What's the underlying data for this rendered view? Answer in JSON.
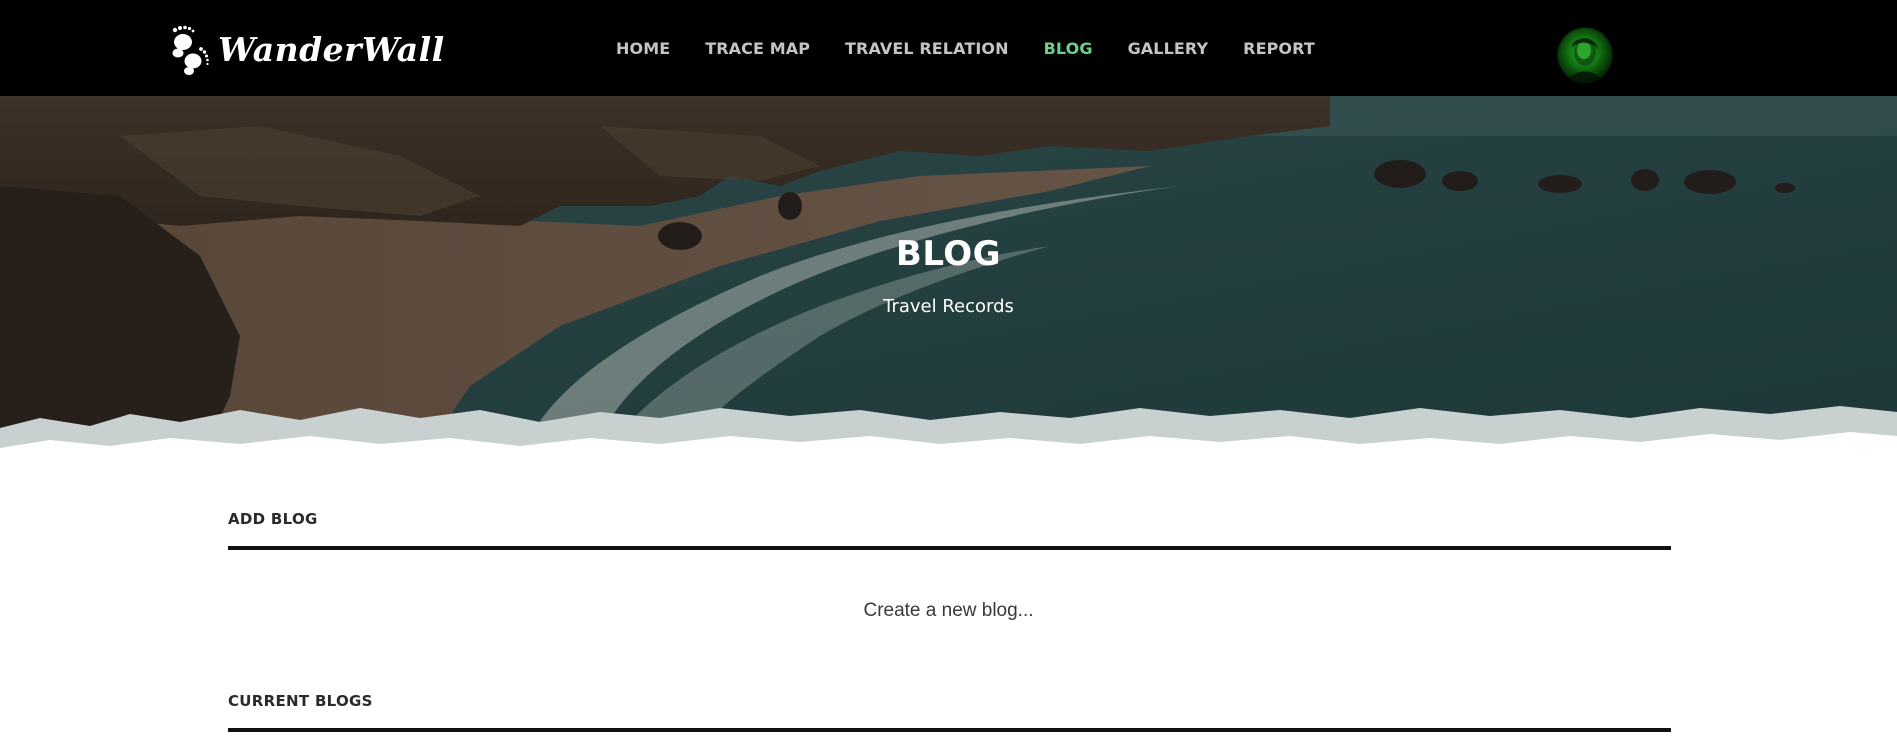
{
  "brand": {
    "name": "WanderWall",
    "logo_icon": "footprints-icon"
  },
  "nav": {
    "items": [
      {
        "label": "HOME",
        "active": false
      },
      {
        "label": "TRACE MAP",
        "active": false
      },
      {
        "label": "TRAVEL RELATION",
        "active": false
      },
      {
        "label": "BLOG",
        "active": true
      },
      {
        "label": "GALLERY",
        "active": false
      },
      {
        "label": "REPORT",
        "active": false
      }
    ],
    "active_color": "#6ccf8e",
    "inactive_color": "#c4c4c4"
  },
  "hero": {
    "title": "BLOG",
    "subtitle": "Travel Records"
  },
  "sections": {
    "add_blog": {
      "title": "ADD BLOG",
      "create_link": "Create a new blog..."
    },
    "current_blogs": {
      "title": "CURRENT BLOGS"
    }
  },
  "user": {
    "avatar_icon": "user-avatar"
  }
}
